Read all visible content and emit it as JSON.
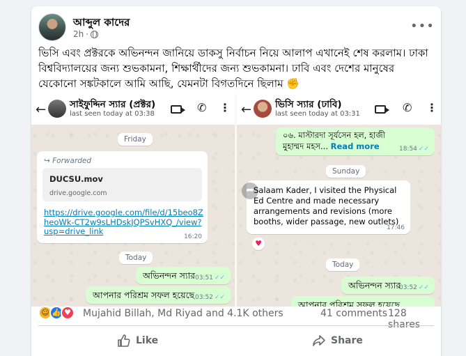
{
  "post": {
    "author": "আব্দুল কাদের",
    "time": "2h",
    "dot": "·",
    "more": "•••",
    "text": "ভিসি এবং প্রক্টরকে অভিনন্দন জানিয়ে ডাকসু নির্বাচন নিয়ে আলাপ এখানেই শেষ করলাম। ঢাকা বিশ্ববিদ্যালয়ের জন্য শুভকামনা, শিক্ষার্থীদের জন্য শুভকামনা। ঢাবি এবং দেশের মানুষের যেকোনো সঙ্কটকালে আমি আছি, যেমনটা বিগতদিনে ছিলাম ✊"
  },
  "left_chat": {
    "name": "সাইফুদ্দিন স্যার (প্রক্টর)",
    "last_seen": "last seen today at 03:38",
    "day1": "Friday",
    "forwarded": "Forwarded",
    "file_name": "DUCSU.mov",
    "file_domain": "drive.google.com",
    "link": "https://drive.google.com/file/d/15beo8ZheoWk-CT2w9sLHDskJQPSvHXQ_/view?usp=drive_link",
    "link_time": "16:20",
    "day2": "Today",
    "msg1": "অভিনন্দন স্যার",
    "msg1_time": "03:51",
    "msg2": "আপনার পরিশ্রম সফল হয়েছে",
    "msg2_time": "03:52"
  },
  "right_chat": {
    "name": "ভিসি স্যার (ঢাবি)",
    "last_seen": "last seen today at 03:31",
    "msg0": "০৬. মাস্টারদা সূর্যসেন হল, হাজী মুহাম্মদ মহস...",
    "read_more": "Read more",
    "msg0_time": "18:54",
    "day1": "Sunday",
    "msg_in": "Salaam Kader, I visited the Physical Ed Centre and made necessary arrangements and revisions (more booths, wider passage, new outlets)",
    "msg_in_time": "17:46",
    "reaction": "♥",
    "day2": "Today",
    "msg1": "অভিনন্দন স্যার",
    "msg1_time": "03:52",
    "msg2": "আপনার পরিশ্রম সফল হয়েছে"
  },
  "ticks": "✓✓",
  "stats": {
    "reactors": "Mujahid Billah, Md Riyad and 4.1K others",
    "comments": "41 comments",
    "shares": "128 shares"
  },
  "actions": {
    "like": "Like",
    "share": "Share"
  },
  "colors": {
    "wa_outgoing": "#d9fdd3",
    "wa_background": "#ece5dd",
    "link": "#027eb5",
    "ticks": "#53bdeb"
  }
}
